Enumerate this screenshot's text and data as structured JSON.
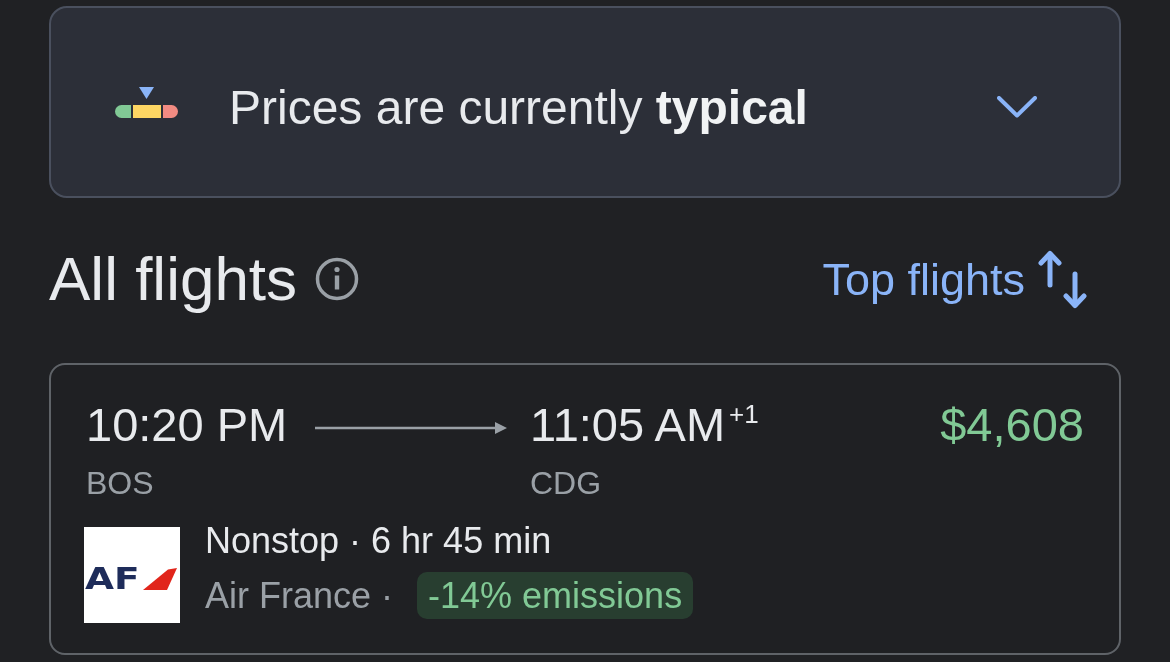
{
  "price_insight": {
    "text": "Prices are currently **typical**",
    "expanded": false
  },
  "results_header": {
    "title": "All flights",
    "sort_button": "Top flights"
  },
  "flights": [
    {
      "departure_time": "10:20 PM",
      "arrival_time": "11:05 AM$^{+1}$",
      "price": "$4,608",
      "origin": "BOS",
      "destination": "CDG",
      "airline_logo": "AF",
      "summary": "Nonstop · 6 hr 45 min",
      "airline": "Air France ·",
      "emissions": "-14% emissions"
    }
  ]
}
